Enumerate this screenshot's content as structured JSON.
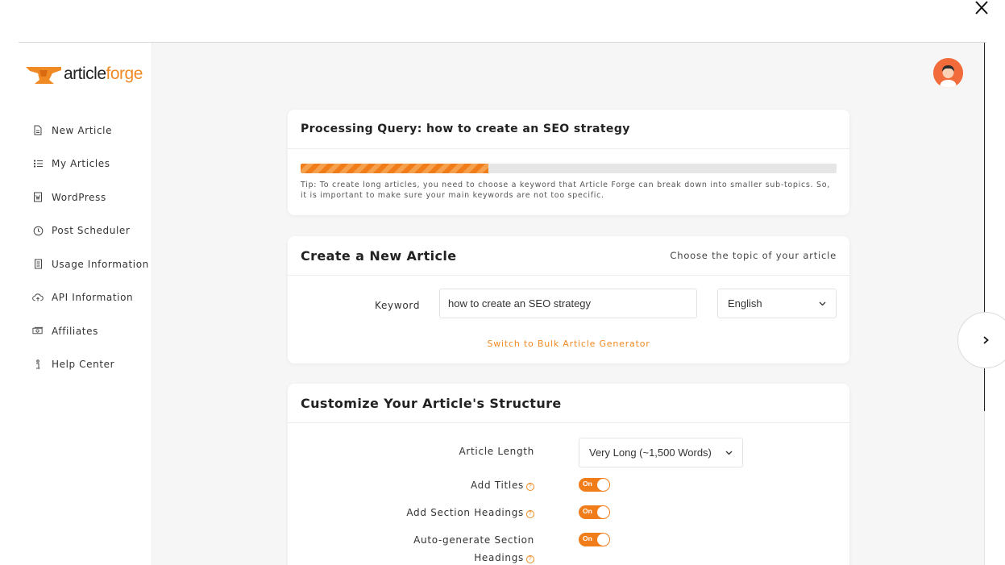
{
  "brand": {
    "logo_part1": "article",
    "logo_part2": "forge",
    "accent": "#f08a24"
  },
  "sidebar": {
    "items": [
      {
        "label": "New Article",
        "icon": "document-icon"
      },
      {
        "label": "My Articles",
        "icon": "list-icon"
      },
      {
        "label": "WordPress",
        "icon": "wordpress-icon"
      },
      {
        "label": "Post Scheduler",
        "icon": "clock-icon"
      },
      {
        "label": "Usage Information",
        "icon": "receipt-icon"
      },
      {
        "label": "API Information",
        "icon": "cloud-upload-icon"
      },
      {
        "label": "Affiliates",
        "icon": "money-icon"
      },
      {
        "label": "Help Center",
        "icon": "info-icon"
      }
    ]
  },
  "processing": {
    "title": "Processing Query: how to create an SEO strategy",
    "progress": 0.35,
    "tip": "Tip: To create long articles, you need to choose a keyword that Article Forge can break down into smaller sub-topics. So, it is important to make sure your main keywords are not too specific."
  },
  "create": {
    "title": "Create a New Article",
    "subtitle": "Choose the topic of your article",
    "keyword_label": "Keyword",
    "keyword_value": "how to create an SEO strategy",
    "language": "English",
    "bulk_link": "Switch to Bulk Article Generator"
  },
  "structure": {
    "title": "Customize Your Article's Structure",
    "length_label": "Article Length",
    "length_value": "Very Long (~1,500 Words)",
    "toggles": [
      {
        "label": "Add Titles",
        "state": "On"
      },
      {
        "label": "Add Section Headings",
        "state": "On"
      },
      {
        "label": "Auto-generate Section",
        "label2": "Headings",
        "state": "On"
      }
    ]
  }
}
